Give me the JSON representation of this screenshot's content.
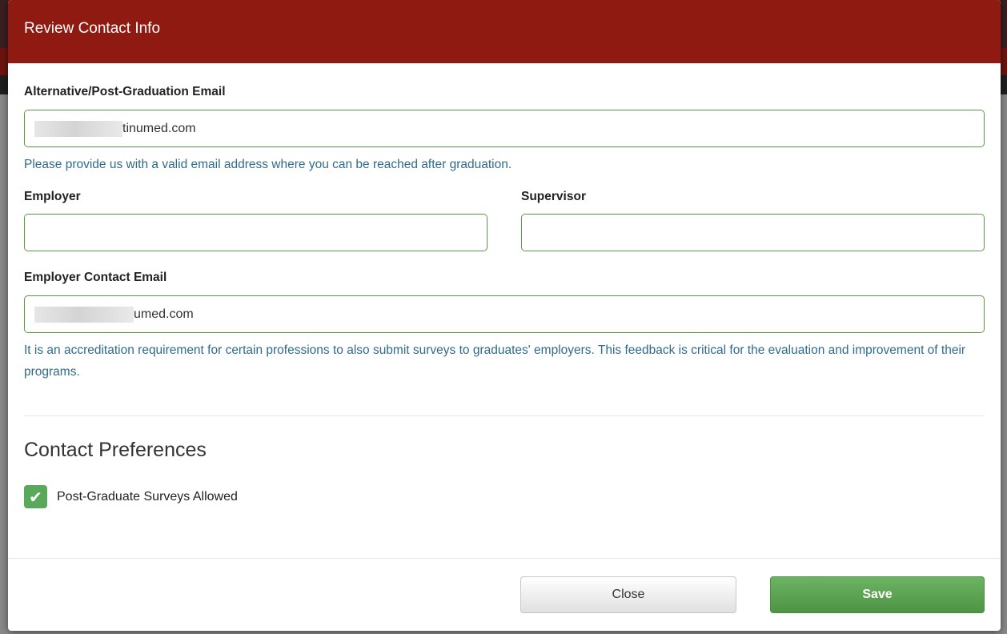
{
  "modal": {
    "title": "Review Contact Info",
    "alt_email": {
      "label": "Alternative/Post-Graduation Email",
      "value_visible_suffix": "tinumed.com",
      "help": "Please provide us with a valid email address where you can be reached after graduation."
    },
    "employer": {
      "label": "Employer",
      "value": ""
    },
    "supervisor": {
      "label": "Supervisor",
      "value": ""
    },
    "employer_email": {
      "label": "Employer Contact Email",
      "value_visible_suffix": "umed.com",
      "help": "It is an accreditation requirement for certain professions to also submit surveys to graduates' employers. This feedback is critical for the evaluation and improvement of their programs."
    },
    "contact_preferences": {
      "title": "Contact Preferences",
      "surveys_allowed": {
        "label": "Post-Graduate Surveys Allowed",
        "checked": true,
        "icon": "checkmark-icon"
      }
    },
    "footer": {
      "close_label": "Close",
      "save_label": "Save"
    }
  },
  "colors": {
    "header": "#8e1a12",
    "input_border": "#5a9a45",
    "help_text": "#2f6b8a",
    "checkbox": "#5aa95a",
    "save_button": "#5aa550"
  }
}
